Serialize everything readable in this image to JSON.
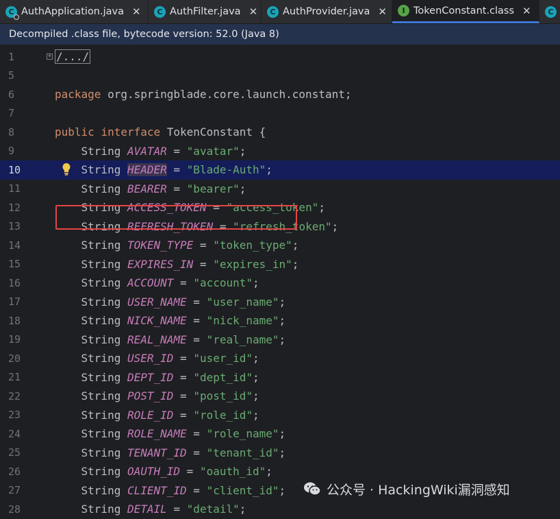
{
  "tabs": [
    {
      "label": "AuthApplication.java",
      "icon": "class-c-icon",
      "active": false
    },
    {
      "label": "AuthFilter.java",
      "icon": "class-c-icon",
      "active": false
    },
    {
      "label": "AuthProvider.java",
      "icon": "class-c-icon",
      "active": false
    },
    {
      "label": "TokenConstant.class",
      "icon": "interface-i-icon",
      "active": true
    }
  ],
  "notice": "Decompiled .class file, bytecode version: 52.0 (Java 8)",
  "editor": {
    "current_line": "10",
    "fold_marker": "/.../",
    "package_line": {
      "kw": "package",
      "name": " org.springblade.core.launch.constant;"
    },
    "interface_line": {
      "kw1": "public",
      "kw2": "interface",
      "name": " TokenConstant {"
    },
    "constants": [
      {
        "line": "9",
        "name": "AVATAR",
        "value": "\"avatar\""
      },
      {
        "line": "10",
        "name": "HEADER",
        "value": "\"Blade-Auth\""
      },
      {
        "line": "11",
        "name": "BEARER",
        "value": "\"bearer\""
      },
      {
        "line": "12",
        "name": "ACCESS_TOKEN",
        "value": "\"access_token\""
      },
      {
        "line": "13",
        "name": "REFRESH_TOKEN",
        "value": "\"refresh_token\""
      },
      {
        "line": "14",
        "name": "TOKEN_TYPE",
        "value": "\"token_type\""
      },
      {
        "line": "15",
        "name": "EXPIRES_IN",
        "value": "\"expires_in\""
      },
      {
        "line": "16",
        "name": "ACCOUNT",
        "value": "\"account\""
      },
      {
        "line": "17",
        "name": "USER_NAME",
        "value": "\"user_name\""
      },
      {
        "line": "18",
        "name": "NICK_NAME",
        "value": "\"nick_name\""
      },
      {
        "line": "19",
        "name": "REAL_NAME",
        "value": "\"real_name\""
      },
      {
        "line": "20",
        "name": "USER_ID",
        "value": "\"user_id\""
      },
      {
        "line": "21",
        "name": "DEPT_ID",
        "value": "\"dept_id\""
      },
      {
        "line": "22",
        "name": "POST_ID",
        "value": "\"post_id\""
      },
      {
        "line": "23",
        "name": "ROLE_ID",
        "value": "\"role_id\""
      },
      {
        "line": "24",
        "name": "ROLE_NAME",
        "value": "\"role_name\""
      },
      {
        "line": "25",
        "name": "TENANT_ID",
        "value": "\"tenant_id\""
      },
      {
        "line": "26",
        "name": "OAUTH_ID",
        "value": "\"oauth_id\""
      },
      {
        "line": "27",
        "name": "CLIENT_ID",
        "value": "\"client_id\""
      },
      {
        "line": "28",
        "name": "DETAIL",
        "value": "\"detail\""
      }
    ],
    "type_word": "String",
    "line_numbers_top": [
      "1",
      "5",
      "6",
      "7",
      "8"
    ]
  },
  "watermark": "公众号 · HackingWiki漏洞感知",
  "colors": {
    "keyword": "#cf8e6d",
    "constant": "#c77dbb",
    "string": "#6aab73",
    "current_line": "#141d5a",
    "highlight_box": "#e54545"
  }
}
